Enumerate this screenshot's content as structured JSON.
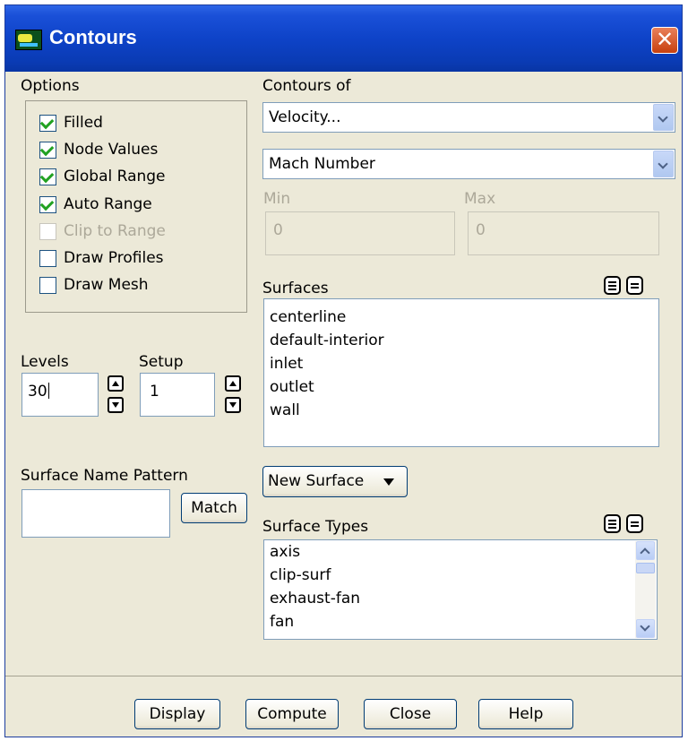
{
  "window": {
    "title": "Contours",
    "close_glyph": "✕"
  },
  "options": {
    "label": "Options",
    "items": [
      {
        "label": "Filled",
        "checked": true,
        "enabled": true
      },
      {
        "label": "Node Values",
        "checked": true,
        "enabled": true
      },
      {
        "label": "Global Range",
        "checked": true,
        "enabled": true
      },
      {
        "label": "Auto Range",
        "checked": true,
        "enabled": true
      },
      {
        "label": "Clip to Range",
        "checked": false,
        "enabled": false
      },
      {
        "label": "Draw Profiles",
        "checked": false,
        "enabled": true
      },
      {
        "label": "Draw Mesh",
        "checked": false,
        "enabled": true
      }
    ]
  },
  "contours_of": {
    "label": "Contours of",
    "category": "Velocity...",
    "variable": "Mach Number",
    "min_label": "Min",
    "min_value": "0",
    "max_label": "Max",
    "max_value": "0"
  },
  "levels": {
    "label": "Levels",
    "value": "30"
  },
  "setup": {
    "label": "Setup",
    "value": "1"
  },
  "surfaces": {
    "label": "Surfaces",
    "items": [
      "centerline",
      "default-interior",
      "inlet",
      "outlet",
      "wall"
    ]
  },
  "pattern": {
    "label": "Surface Name Pattern",
    "value": "",
    "match_label": "Match"
  },
  "new_surface": {
    "label": "New Surface"
  },
  "surface_types": {
    "label": "Surface Types",
    "items": [
      "axis",
      "clip-surf",
      "exhaust-fan",
      "fan"
    ]
  },
  "footer": {
    "display": "Display",
    "compute": "Compute",
    "close": "Close",
    "help": "Help"
  }
}
